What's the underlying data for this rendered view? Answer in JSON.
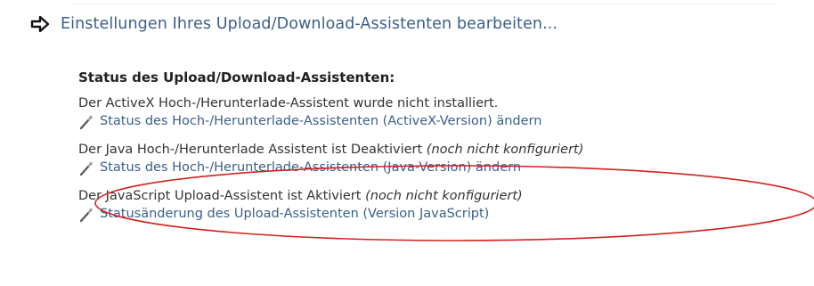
{
  "header": {
    "link_text": "Einstellungen Ihres Upload/Download-Assistenten bearbeiten...",
    "icon": "arrow-right-icon"
  },
  "panel": {
    "title": "Status des Upload/Download-Assistenten:",
    "sections": [
      {
        "status_text": "Der ActiveX Hoch-/Herunterlade-Assistent wurde nicht installiert.",
        "status_note": "",
        "link_text": "Status des Hoch-/Herunterlade-Assistenten (ActiveX-Version) ändern",
        "icon": "magic-wand-icon"
      },
      {
        "status_text": "Der Java Hoch-/Herunterlade Assistent ist Deaktiviert ",
        "status_note": "(noch nicht konfiguriert)",
        "link_text": "Status des Hoch-/Herunterlade-Assistenten (Java-Version) ändern",
        "icon": "magic-wand-icon",
        "highlighted": true
      },
      {
        "status_text": "Der JavaScript Upload-Assistent ist Aktiviert ",
        "status_note": "(noch nicht konfiguriert)",
        "link_text": "Statusänderung des Upload-Assistenten (Version JavaScript)",
        "icon": "magic-wand-icon"
      }
    ]
  },
  "colors": {
    "link": "#3a5f8a",
    "text": "#333333",
    "highlight": "#d42020"
  }
}
